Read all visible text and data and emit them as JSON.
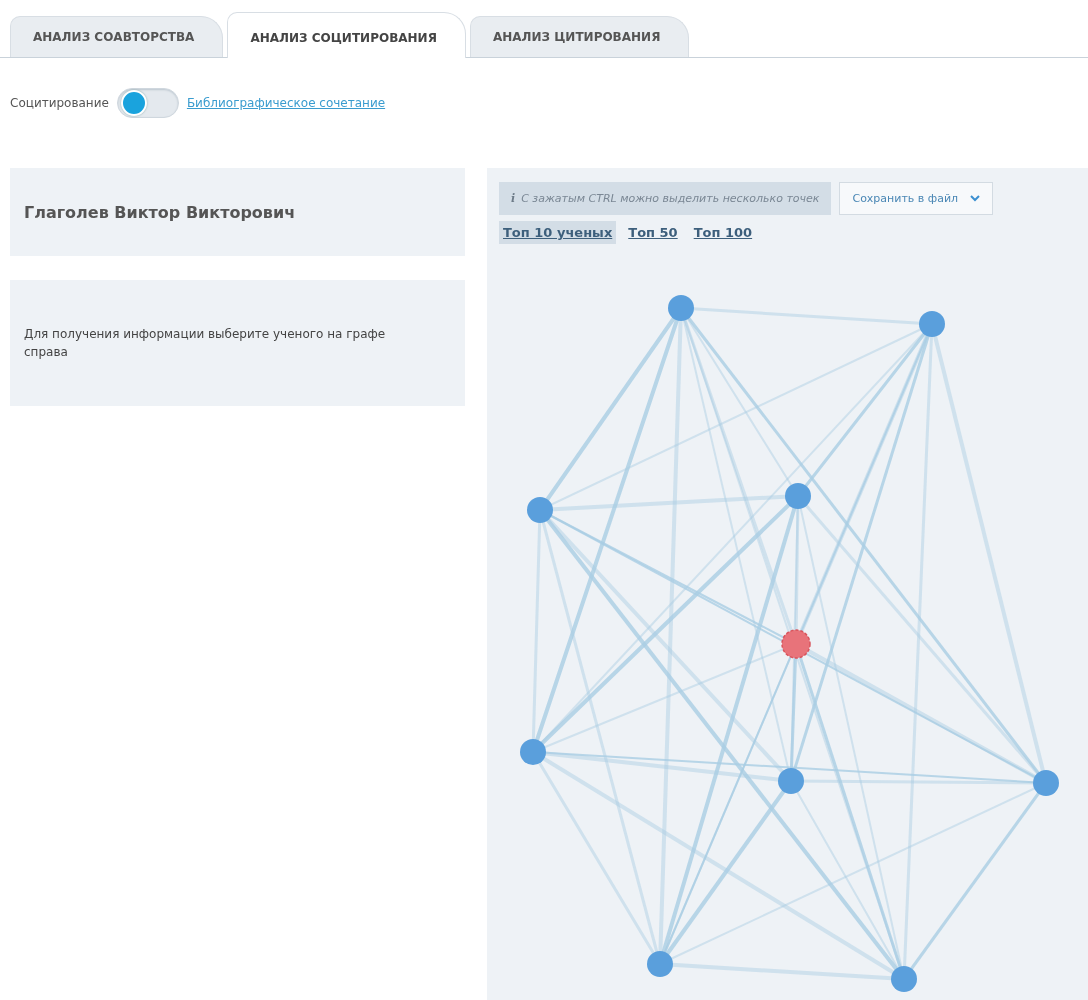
{
  "tabs": [
    {
      "label": "АНАЛИЗ СОАВТОРСТВА",
      "selected": false
    },
    {
      "label": "АНАЛИЗ СОЦИТИРОВАНИЯ",
      "selected": true
    },
    {
      "label": "АНАЛИЗ ЦИТИРОВАНИЯ",
      "selected": false
    }
  ],
  "mode_switch": {
    "left_label": "Социтирование",
    "right_label": "Библиографическое сочетание",
    "on": false
  },
  "scientist": {
    "name": "Глаголев Виктор Викторович"
  },
  "info": {
    "text": "Для получения информации выберите ученого на графе справа"
  },
  "graph_panel": {
    "hint_icon": "i",
    "hint": "С зажатым CTRL можно выделить несколько точек",
    "save_button": "Сохранить в файл",
    "filters": [
      {
        "label": "Топ 10 ученых",
        "selected": true
      },
      {
        "label": "Топ 50",
        "selected": false
      },
      {
        "label": "Топ 100",
        "selected": false
      }
    ],
    "nodes": [
      {
        "selected": false
      },
      {
        "selected": false
      },
      {
        "selected": false
      },
      {
        "selected": false
      },
      {
        "selected": true
      },
      {
        "selected": false
      },
      {
        "selected": false
      },
      {
        "selected": false
      },
      {
        "selected": false
      },
      {
        "selected": false
      }
    ]
  }
}
